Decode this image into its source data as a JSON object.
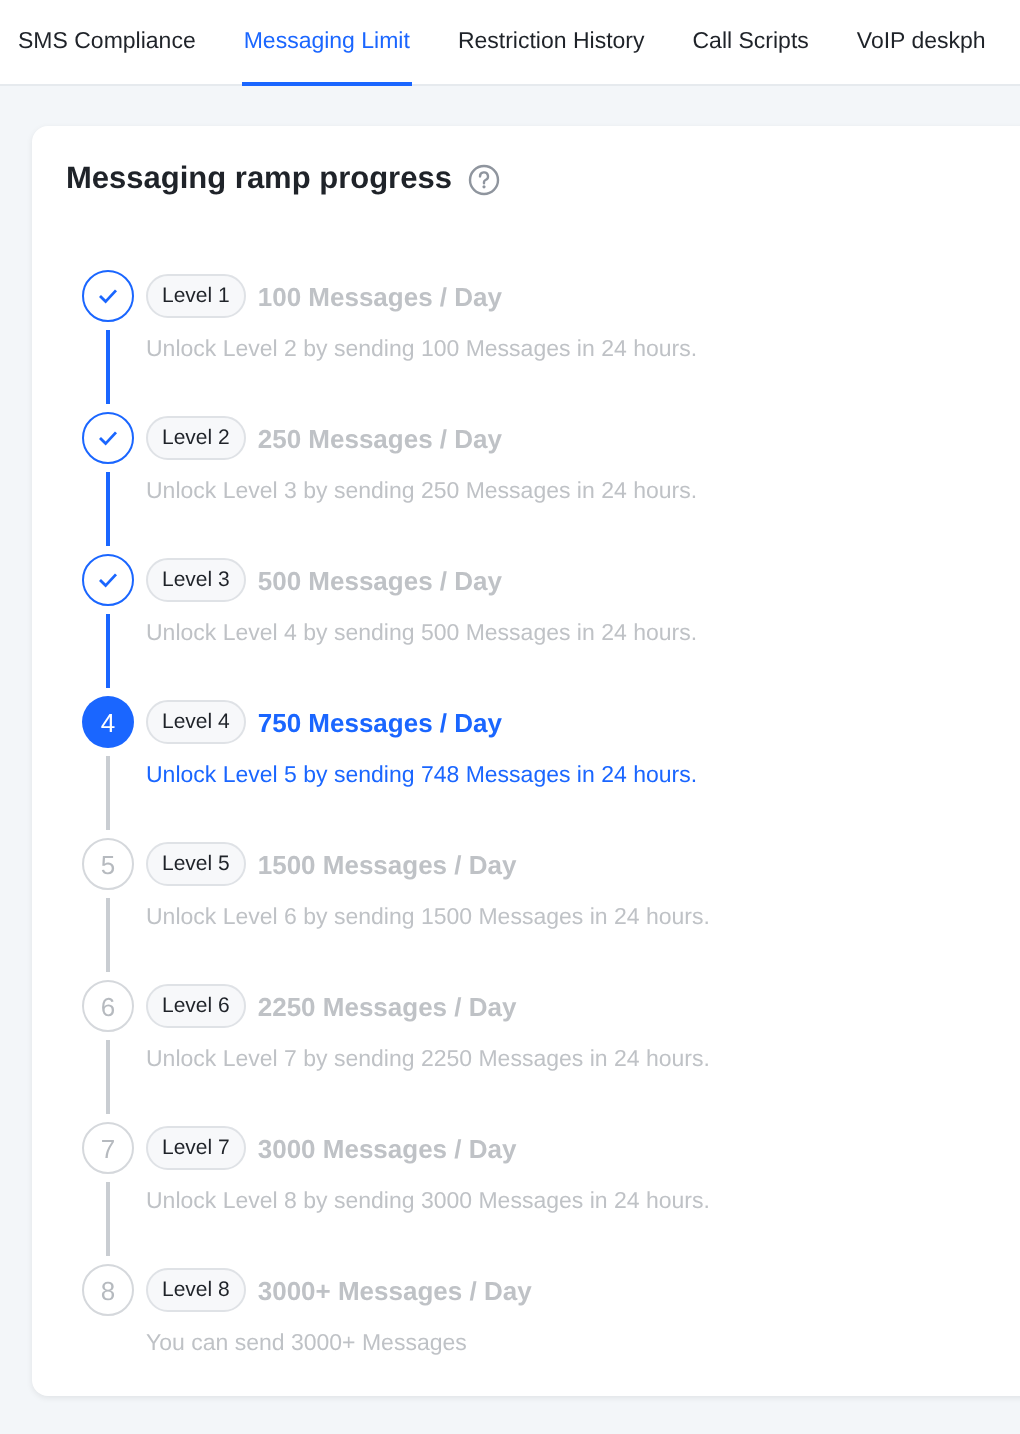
{
  "tabs": [
    {
      "label": "SMS Compliance",
      "selected": false
    },
    {
      "label": "Messaging Limit",
      "selected": true
    },
    {
      "label": "Restriction History",
      "selected": false
    },
    {
      "label": "Call Scripts",
      "selected": false
    },
    {
      "label": "VoIP deskph",
      "selected": false
    }
  ],
  "card": {
    "title": "Messaging ramp progress",
    "steps": [
      {
        "completed": true,
        "current": false,
        "badge": "Level 1",
        "title": "100 Messages / Day",
        "description": "Unlock Level 2 by sending 100 Messages in 24 hours."
      },
      {
        "completed": true,
        "current": false,
        "badge": "Level 2",
        "title": "250 Messages / Day",
        "description": "Unlock Level 3 by sending 250 Messages in 24 hours."
      },
      {
        "completed": true,
        "current": false,
        "badge": "Level 3",
        "title": "500 Messages / Day",
        "description": "Unlock Level 4 by sending 500 Messages in 24 hours."
      },
      {
        "completed": false,
        "current": true,
        "number": "4",
        "badge": "Level 4",
        "title": "750 Messages / Day",
        "description": "Unlock Level 5 by sending 748 Messages in 24 hours."
      },
      {
        "completed": false,
        "current": false,
        "number": "5",
        "badge": "Level 5",
        "title": "1500 Messages / Day",
        "description": "Unlock Level 6 by sending 1500 Messages in 24 hours."
      },
      {
        "completed": false,
        "current": false,
        "number": "6",
        "badge": "Level 6",
        "title": "2250 Messages / Day",
        "description": "Unlock Level 7 by sending 2250 Messages in 24 hours."
      },
      {
        "completed": false,
        "current": false,
        "number": "7",
        "badge": "Level 7",
        "title": "3000 Messages / Day",
        "description": "Unlock Level 8 by sending 3000 Messages in 24 hours."
      },
      {
        "completed": false,
        "current": false,
        "number": "8",
        "badge": "Level 8",
        "title": "3000+ Messages / Day",
        "description": "You can send 3000+ Messages"
      }
    ]
  }
}
